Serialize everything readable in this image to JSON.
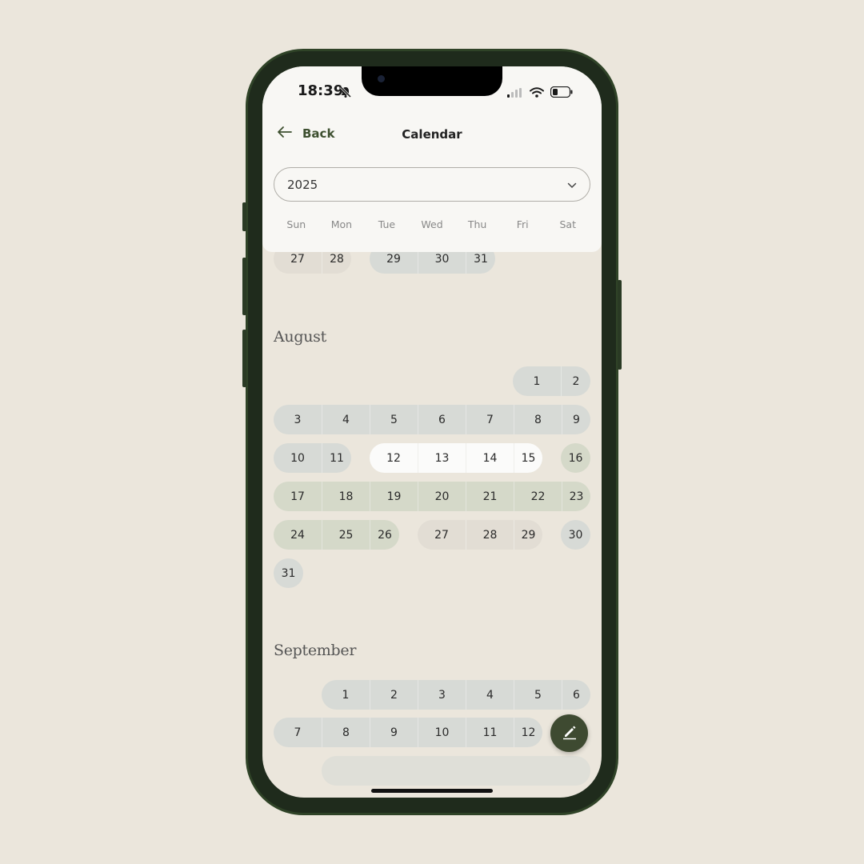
{
  "status": {
    "time": "18:39"
  },
  "nav": {
    "back_label": "Back",
    "title": "Calendar"
  },
  "year_select": {
    "value": "2025"
  },
  "weekdays": [
    "Sun",
    "Mon",
    "Tue",
    "Wed",
    "Thu",
    "Fri",
    "Sat"
  ],
  "july_tail": {
    "row": [
      "27",
      "28",
      "29",
      "30",
      "31"
    ]
  },
  "august": {
    "title": "August",
    "days": [
      "1",
      "2",
      "3",
      "4",
      "5",
      "6",
      "7",
      "8",
      "9",
      "10",
      "11",
      "12",
      "13",
      "14",
      "15",
      "16",
      "17",
      "18",
      "19",
      "20",
      "21",
      "22",
      "23",
      "24",
      "25",
      "26",
      "27",
      "28",
      "29",
      "30",
      "31"
    ]
  },
  "september": {
    "title": "September",
    "days": [
      "1",
      "2",
      "3",
      "4",
      "5",
      "6",
      "7",
      "8",
      "9",
      "10",
      "11",
      "12"
    ]
  },
  "colors": {
    "accent": "#3e4a31",
    "neutral_pill": "#d7dad6",
    "tan_pill": "#e2ddd4",
    "sage_pill": "#d5d9c9",
    "highlight_pill": "#fbfbfa",
    "background": "#ebe6dc"
  },
  "icons": {
    "back": "arrow-left-icon",
    "dropdown": "chevron-down-icon",
    "fab": "pencil-icon",
    "bell": "bell-slash-icon"
  }
}
